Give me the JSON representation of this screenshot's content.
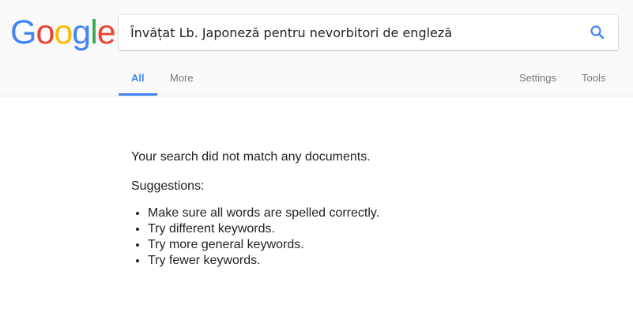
{
  "logo": {
    "letters": [
      {
        "char": "G",
        "color": "#4285f4"
      },
      {
        "char": "o",
        "color": "#ea4335"
      },
      {
        "char": "o",
        "color": "#fbbc05"
      },
      {
        "char": "g",
        "color": "#4285f4"
      },
      {
        "char": "l",
        "color": "#34a853"
      },
      {
        "char": "e",
        "color": "#ea4335"
      }
    ]
  },
  "search": {
    "value": "Învățat Lb. Japoneză pentru nevorbitori de engleză",
    "icon": "search-icon",
    "icon_color": "#4285f4"
  },
  "tabs": {
    "all": "All",
    "more": "More",
    "settings": "Settings",
    "tools": "Tools",
    "active_color": "#4285f4"
  },
  "results": {
    "no_match": "Your search did not match any documents.",
    "suggestions_title": "Suggestions:",
    "suggestions": [
      "Make sure all words are spelled correctly.",
      "Try different keywords.",
      "Try more general keywords.",
      "Try fewer keywords."
    ]
  }
}
